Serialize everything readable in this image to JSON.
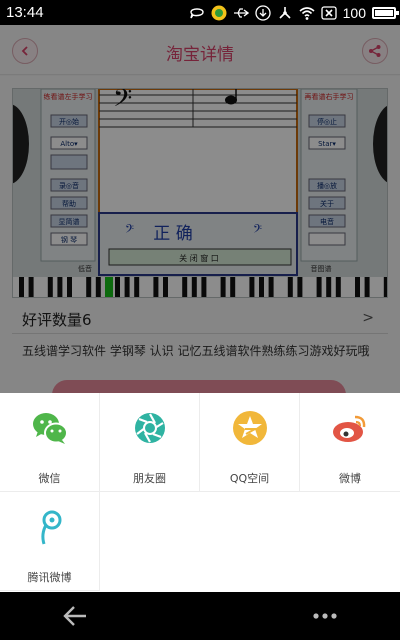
{
  "status_bar": {
    "time": "13:44",
    "battery_level": "100",
    "icons": [
      "chat-bubble-icon",
      "app-badge-icon",
      "usb-icon",
      "download-icon",
      "debug-icon",
      "wifi-icon",
      "no-sim-icon",
      "battery-icon"
    ]
  },
  "header": {
    "title": "淘宝详情",
    "back_icon": "back-arrow-icon",
    "share_icon": "share-icon"
  },
  "product": {
    "image_texts": {
      "left_panel_title": "练看谱左手学习",
      "right_panel_title": "再看谱右手学习",
      "left_buttons": [
        "开◎始",
        "Alto▾",
        "录◎音",
        "帮助",
        "显简谱",
        "钢 琴"
      ],
      "right_buttons": [
        "停◎止",
        "Star▾",
        "播◎放",
        "关于",
        "电音"
      ],
      "result": "正 确",
      "close_window": "关 闭 窗 口",
      "bottom_left_label": "低音",
      "bottom_right_label": "音图谱"
    },
    "rating_label": "好评数量6",
    "description": "五线谱学习软件 学钢琴 认识 记忆五线谱软件熟练练习游戏好玩哦"
  },
  "share_sheet": {
    "items": [
      {
        "label": "微信",
        "icon": "wechat-icon",
        "color": "#4fb64a"
      },
      {
        "label": "朋友圈",
        "icon": "moments-icon",
        "color": "#2fb3a2"
      },
      {
        "label": "QQ空间",
        "icon": "qzone-icon",
        "color": "#f1b73a"
      },
      {
        "label": "微博",
        "icon": "weibo-icon",
        "color": "#e25545"
      },
      {
        "label": "腾讯微博",
        "icon": "tencent-weibo-icon",
        "color": "#34b6c9"
      }
    ]
  },
  "nav_bar": {
    "back_icon": "nav-back-icon",
    "more_icon": "nav-more-icon"
  },
  "colors": {
    "accent": "#d8436b",
    "status_bar": "#000000",
    "header_bg": "#f5f5f5"
  }
}
